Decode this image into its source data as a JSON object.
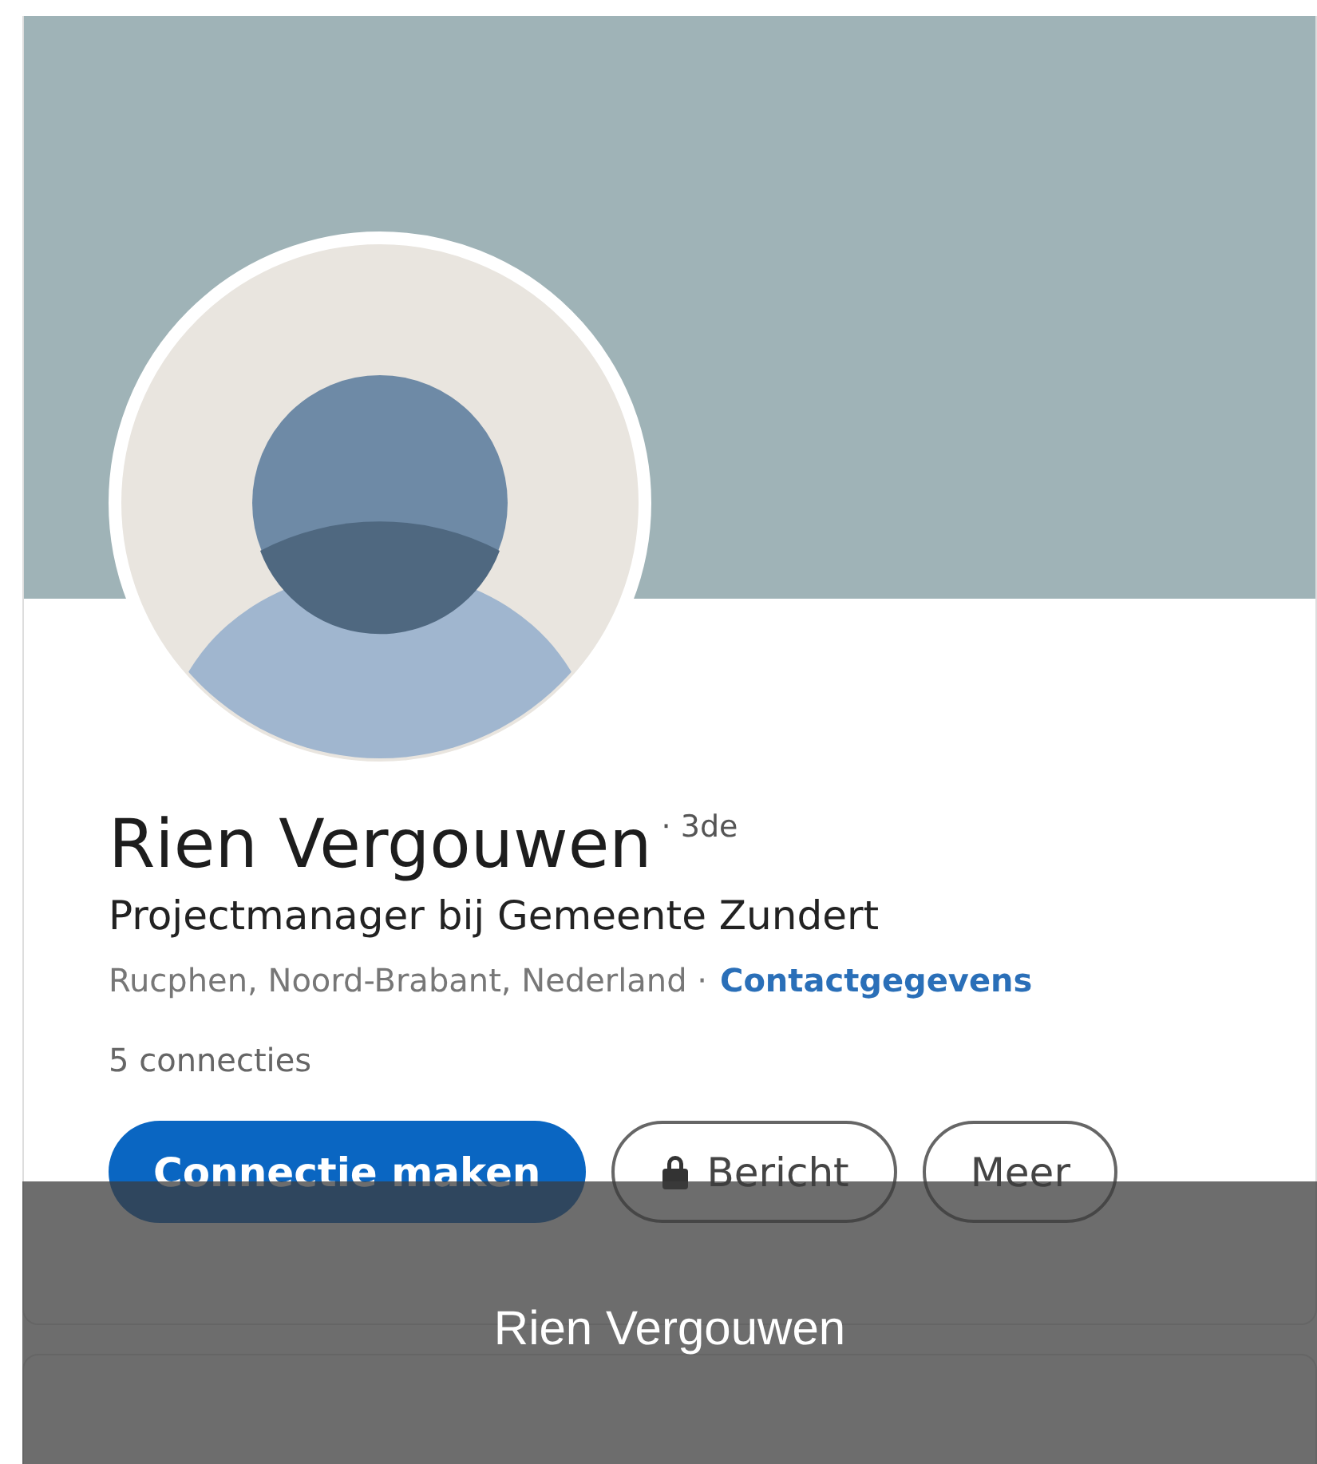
{
  "profile": {
    "name": "Rien Vergouwen",
    "degree": "· 3de",
    "headline": "Projectmanager bij Gemeente Zundert",
    "location": "Rucphen, Noord-Brabant, Nederland ·",
    "contact_link": "Contactgegevens",
    "connections": "5 connecties"
  },
  "buttons": [
    {
      "kind": "primary",
      "label": "Connectie maken"
    },
    {
      "kind": "lock",
      "label": "Bericht"
    },
    {
      "kind": "plain",
      "label": "Meer"
    }
  ],
  "caption": "Rien Vergouwen"
}
